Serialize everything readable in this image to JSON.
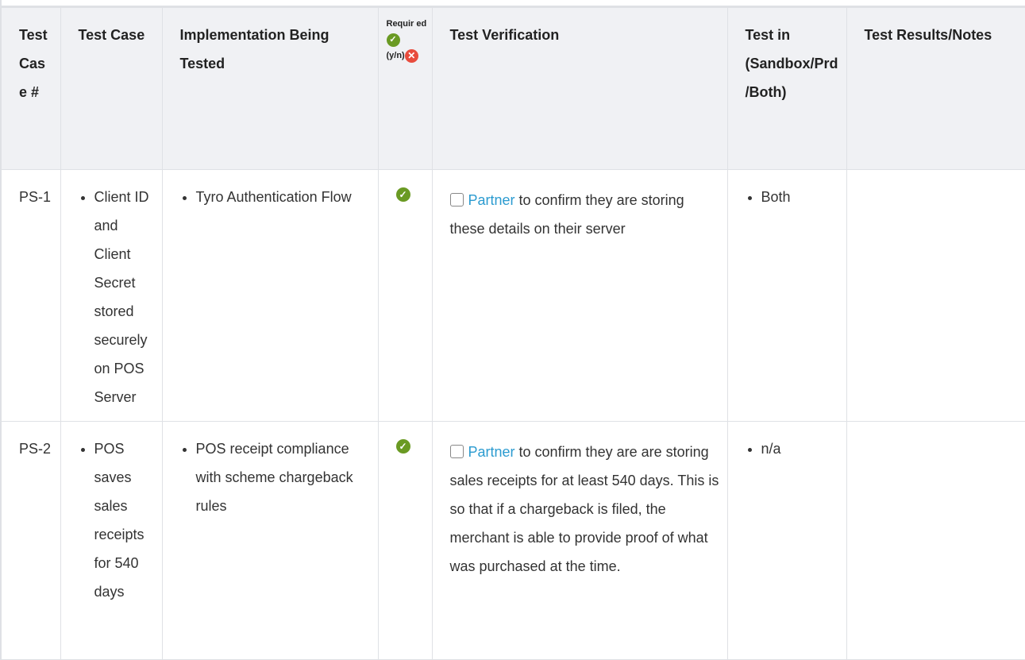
{
  "headers": {
    "case_no": "Test Case #",
    "test_case": "Test Case",
    "implementation": "Implementation Being Tested",
    "required_a": "Requir ed",
    "required_b": "(y/n)",
    "verification": "Test Verification",
    "test_in": "Test in (Sandbox/Prd/Both)",
    "results": "Test Results/Notes"
  },
  "rows": [
    {
      "case_no": "PS-1",
      "test_case": "Client ID and Client Secret stored securely on POS Server",
      "implementation": "Tyro Authentication Flow",
      "required": "yes",
      "verification_link": "Partner",
      "verification_text": " to confirm they are storing these details on their server",
      "test_in": "Both",
      "results": ""
    },
    {
      "case_no": "PS-2",
      "test_case": "POS saves sales receipts for 540 days",
      "implementation": "POS receipt compliance with scheme chargeback rules",
      "required": "yes",
      "verification_link": "Partner",
      "verification_text": " to confirm they are are storing sales receipts for at least 540 days. This is so that if a chargeback is filed, the merchant is able to provide proof of what was purchased at the time.",
      "test_in": "n/a",
      "results": ""
    }
  ],
  "icons": {
    "required_yes": "check-circle-icon",
    "required_no": "x-circle-icon"
  },
  "colors": {
    "header_bg": "#f0f1f4",
    "border": "#dfe1e5",
    "link": "#2b9bd0",
    "ok_green": "#6a9a23",
    "no_red": "#e84c3d"
  }
}
